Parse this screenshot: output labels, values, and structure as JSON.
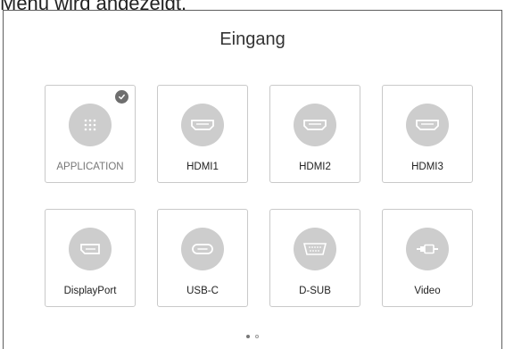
{
  "caption": "Menü wird angezeigt.",
  "title": "Eingang",
  "inputs": [
    {
      "label": "APPLICATION",
      "icon": "app-grid-icon",
      "selected": true
    },
    {
      "label": "HDMI1",
      "icon": "hdmi-port-icon"
    },
    {
      "label": "HDMI2",
      "icon": "hdmi-port-icon"
    },
    {
      "label": "HDMI3",
      "icon": "hdmi-port-icon"
    },
    {
      "label": "DisplayPort",
      "icon": "displayport-icon"
    },
    {
      "label": "USB-C",
      "icon": "usb-c-port-icon"
    },
    {
      "label": "D-SUB",
      "icon": "vga-port-icon"
    },
    {
      "label": "Video",
      "icon": "av-cable-icon"
    }
  ],
  "pagination": {
    "pages": 2,
    "current": 1
  },
  "colors": {
    "icon_bg": "#cdcdcd",
    "tile_border": "#c9c9c9",
    "check": "#6e6e6e"
  }
}
